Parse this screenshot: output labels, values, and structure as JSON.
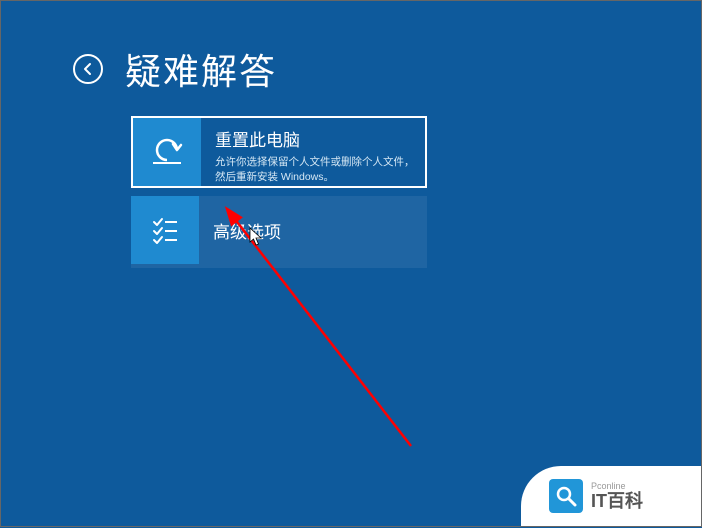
{
  "header": {
    "title": "疑难解答"
  },
  "options": [
    {
      "title": "重置此电脑",
      "description": "允许你选择保留个人文件或删除个人文件，然后重新安装 Windows。",
      "selected": true,
      "icon": "reset-icon"
    },
    {
      "title": "高级选项",
      "description": "",
      "selected": false,
      "icon": "checklist-icon"
    }
  ],
  "watermark": {
    "sub": "Pconline",
    "main": "IT百科"
  },
  "colors": {
    "background": "#0e5a9c",
    "tile_icon_bg": "#1f8ad0",
    "arrow": "#ff0000",
    "watermark_accent": "#2196d8"
  }
}
